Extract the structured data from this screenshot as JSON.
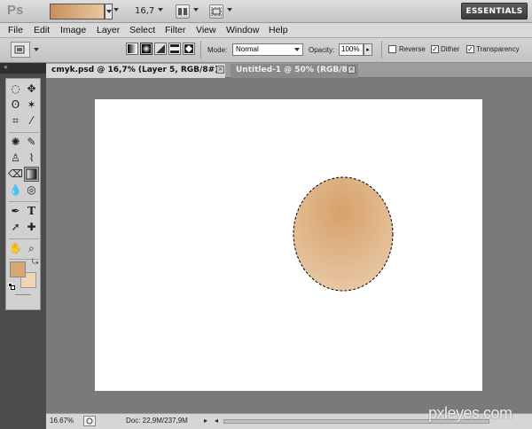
{
  "app": {
    "logo": "Ps",
    "workspace_button": "ESSENTIALS",
    "zoom_value": "16,7"
  },
  "titlebar": {
    "br_label": "Br",
    "mb_label": "Mb"
  },
  "menu": [
    "File",
    "Edit",
    "Image",
    "Layer",
    "Select",
    "Filter",
    "View",
    "Window",
    "Help"
  ],
  "options": {
    "mode_label": "Mode:",
    "mode_value": "Normal",
    "opacity_label": "Opacity:",
    "opacity_value": "100%",
    "reverse_label": "Reverse",
    "reverse_checked": false,
    "dither_label": "Dither",
    "dither_checked": true,
    "transparency_label": "Transparency",
    "transparency_checked": true,
    "gradient_preset_colors": [
      "#c8905a",
      "#e8c7a0"
    ]
  },
  "tabs": [
    {
      "label": "cmyk.psd @ 16,7% (Layer 5, RGB/8#) *",
      "active": true
    },
    {
      "label": "Untitled-1 @ 50% (RGB/8)",
      "active": false
    }
  ],
  "status": {
    "zoom": "16.67%",
    "doc_info": "Doc: 22,9M/237,9M"
  },
  "colors": {
    "foreground": "#d8a574",
    "background": "#efd4b5",
    "ellipse_center": "#d6a16a",
    "ellipse_edge": "#e8c8a4"
  },
  "watermark": "pxleyes.com",
  "icons": {
    "marquee": "◌",
    "move": "✥",
    "lasso": "ʘ",
    "magic_wand": "✶",
    "crop": "⌗",
    "eyedropper": "⁄",
    "healing": "✺",
    "brush": "✎",
    "stamp": "♙",
    "history_brush": "⌇",
    "eraser": "⌫",
    "gradient": "▤",
    "blur": "💧",
    "dodge": "◎",
    "pen": "✒",
    "type": "T",
    "path_select": "➚",
    "shape": "✚",
    "hand": "✋",
    "zoom": "⌕",
    "swap": "⤿",
    "tab_close": "×",
    "chevron": "▾",
    "opacity_arrow": "▸",
    "checkmark": "✓"
  }
}
